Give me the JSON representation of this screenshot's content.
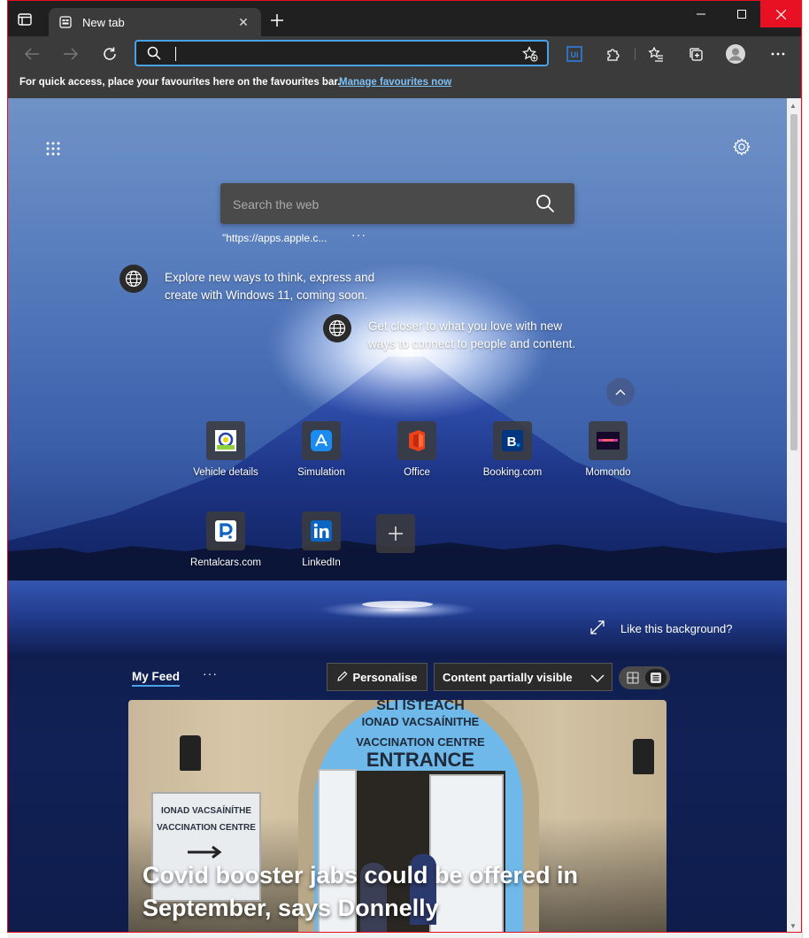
{
  "browser": {
    "tab_title": "New tab",
    "address_value": "",
    "fav_message": "For quick access, place your favourites here on the favourites bar.",
    "fav_link": "Manage favourites now"
  },
  "newtab": {
    "search_placeholder": "Search the web",
    "suggestion": "\"https://apps.apple.c...",
    "suggestion_more": "···",
    "tip1": [
      "Explore new ways to think, express and",
      "create with Windows 11, coming soon."
    ],
    "tip2": [
      "Get closer to what you love with new",
      "ways to connect to people and content."
    ],
    "quick_links": [
      {
        "label": "Vehicle details",
        "icon": "vehicle-details-icon"
      },
      {
        "label": "Simulation",
        "icon": "app-store-icon"
      },
      {
        "label": "Office",
        "icon": "office-icon"
      },
      {
        "label": "Booking.com",
        "icon": "booking-icon"
      },
      {
        "label": "Momondo",
        "icon": "momondo-icon"
      },
      {
        "label": "Rentalcars.com",
        "icon": "rentalcars-icon"
      },
      {
        "label": "LinkedIn",
        "icon": "linkedin-icon"
      }
    ],
    "like_background": "Like this background?"
  },
  "feed": {
    "my_feed": "My Feed",
    "more": "···",
    "personalise": "Personalise",
    "content_visibility": "Content partially visible",
    "article": {
      "headline_line1": "Covid booster jabs could be offered in",
      "headline_line2": "September, says Donnelly",
      "sign_line1": "SLI ISTEACH",
      "sign_line2": "IONAD VACSAÍNITHE",
      "sign_line3": "VACCINATION CENTRE",
      "sign_line4": "ENTRANCE",
      "small_sign1": "IONAD VACSAÍNÍTHE",
      "small_sign2": "VACCINATION CENTRE"
    }
  },
  "colors": {
    "accent": "#4aa3e8",
    "close_red": "#e81123",
    "toolbar": "#3b3b3b",
    "titlebar": "#202020"
  }
}
